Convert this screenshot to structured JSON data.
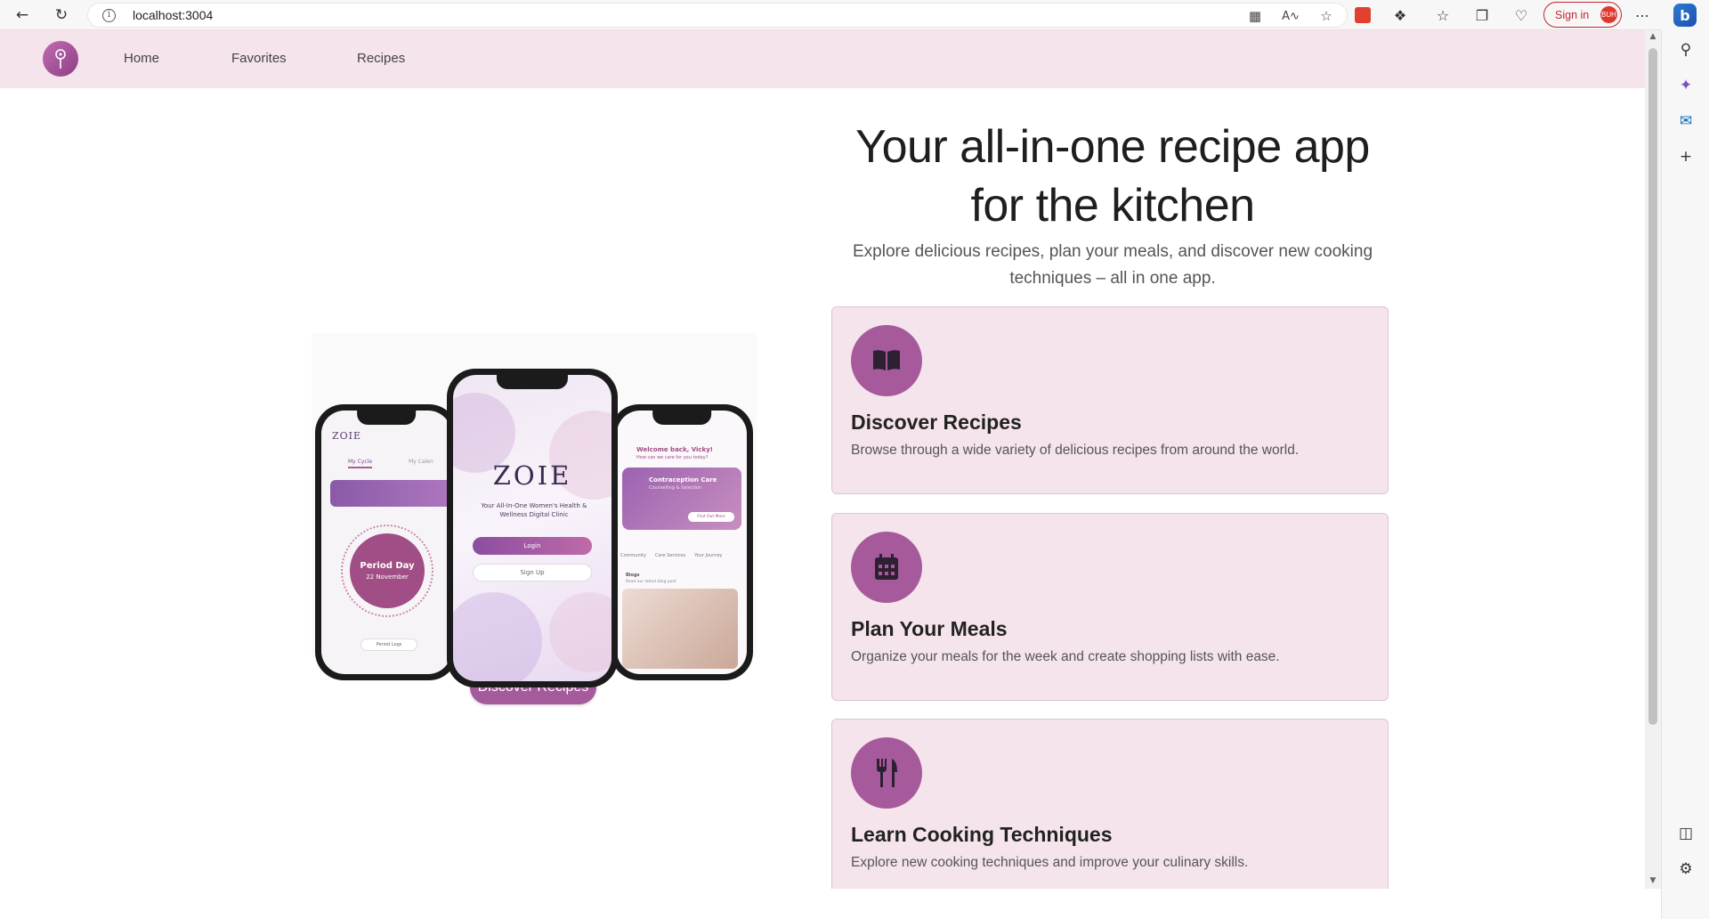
{
  "browser": {
    "url": "localhost:3004",
    "signin_label": "Sign in",
    "signin_badge": "BUH"
  },
  "nav": {
    "items": [
      {
        "label": "Home"
      },
      {
        "label": "Favorites"
      },
      {
        "label": "Recipes"
      }
    ]
  },
  "hero": {
    "title": "Your all-in-one recipe app for the kitchen",
    "subtitle": "Explore delicious recipes, plan your meals, and discover new cooking techniques – all in one app.",
    "cta_label": "Discover Recipes"
  },
  "features": [
    {
      "icon": "book-open-icon",
      "title": "Discover Recipes",
      "text": "Browse through a wide variety of delicious recipes from around the world."
    },
    {
      "icon": "calendar-icon",
      "title": "Plan Your Meals",
      "text": "Organize your meals for the week and create shopping lists with ease."
    },
    {
      "icon": "utensils-icon",
      "title": "Learn Cooking Techniques",
      "text": "Explore new cooking techniques and improve your culinary skills."
    }
  ],
  "phone_mockup": {
    "center_brand": "ZOIE",
    "center_tagline": "Your All-In-One Women's Health & Wellness Digital Clinic",
    "center_login": "Login",
    "center_signup": "Sign Up",
    "left_brand": "ZOIE",
    "left_tab": "My Cycle",
    "left_tab2": "My Calen",
    "left_period_title": "Period Day",
    "left_period_date": "22 November",
    "left_button": "Period Logs",
    "right_welcome": "Welcome back, Vicky!",
    "right_question": "How can we care for you today?",
    "right_card_title": "Contraception Care",
    "right_card_sub": "Counselling & Selection",
    "right_card_btn": "Find Out More",
    "right_tab1": "Community",
    "right_tab2": "Care Services",
    "right_tab3": "Your Journey",
    "right_blog": "Blogs",
    "right_blog_sub": "Read our latest blog post"
  },
  "colors": {
    "accent": "#a65a9c",
    "navbar_bg": "#f5e4ec",
    "card_bg": "#f5e4ec"
  }
}
